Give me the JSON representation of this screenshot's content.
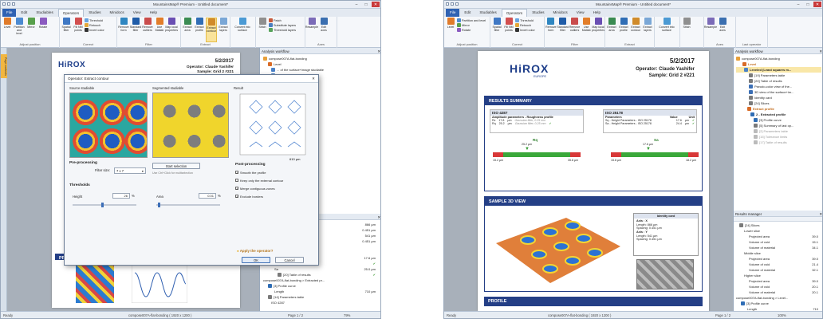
{
  "app": {
    "title": "MountainsMap® Premium - Untitled document*",
    "tabs": [
      "File",
      "Edit",
      "Studiables",
      "Operators",
      "Studies",
      "Minidocs",
      "View",
      "Help"
    ],
    "active_tab": "Operators",
    "ribbon": [
      {
        "group": "Adjust position",
        "buttons": [
          "Level",
          "Partition and level",
          "Mirror",
          "Rotate"
        ]
      },
      {
        "group": "Correct",
        "buttons": [
          "Spatial filter",
          "Fill NM points"
        ],
        "small": [
          "Threshold",
          "Retouch",
          "Invert color"
        ]
      },
      {
        "group": "Filter",
        "buttons": [
          "Remove form",
          "Standard filter",
          "Remove outliers",
          "Use Matlab",
          "Map local properties"
        ]
      },
      {
        "group": "Extract",
        "buttons": [
          "Extract area",
          "Extract profile",
          "Extract contour",
          "Extract layers"
        ]
      },
      {
        "group": "",
        "buttons": [
          "Convert into surface"
        ]
      },
      {
        "group": "",
        "buttons": [
          "Stitch"
        ],
        "small": [
          "Patch",
          "Substitute layers",
          "Threshold layers"
        ]
      },
      {
        "group": "Axes",
        "buttons": [
          "Resample",
          "Edit axes"
        ]
      },
      {
        "group": "Last operator",
        "buttons": []
      }
    ],
    "status": {
      "ready": "Ready",
      "file": "compose007A-flat-bonding ( 1920 x 1200 )",
      "page": "Page 1 / 2",
      "zoom": "100%",
      "zoom_left": "79%"
    }
  },
  "report": {
    "brand": "HiROX",
    "brand_sub": "EUROPE",
    "date": "5/2/2017",
    "operator": "Operator: Claude Yashifer",
    "sample": "Sample: Grid 2 #221",
    "results_title": "RESULTS SUMMARY",
    "iso1": {
      "title": "ISO 4287",
      "params": "Amplitude parameters - Roughness profile",
      "rows": [
        {
          "name": "Rz",
          "val": "17.8",
          "unit": "µm",
          "note": "Gaussian filter, 0.25 mm"
        },
        {
          "name": "Rq",
          "val": "25.2",
          "unit": "µm",
          "note": "Gaussian filter, 0.25 mm"
        }
      ],
      "marker": "Rq",
      "marker_val": "25.2 µm",
      "left": "15.2 µm",
      "right": "35.8 µm"
    },
    "iso2": {
      "title": "ISO 25178",
      "params": "Parameters",
      "value_col": "Value",
      "unit_col": "Unit",
      "rows": [
        {
          "name": "Sq - Height Parameters - ISO 25178",
          "val": "17.6",
          "unit": "µm"
        },
        {
          "name": "Sa - Height Parameters - ISO 25178",
          "val": "24.4",
          "unit": "µm"
        }
      ],
      "marker": "Sa",
      "marker_val": "17.6 µm",
      "left": "15.8 µm",
      "right": "18.2 µm"
    },
    "view_title": "SAMPLE 3D VIEW",
    "identity": {
      "title": "Identity card",
      "axis_x": "Axis : X",
      "len_x": "Length: 866 µm",
      "sp_x": "Spacing: 0.451 µm",
      "axis_y": "Axis : Y",
      "len_y": "Length: 541 µm",
      "sp_y": "Spacing: 0.451 µm"
    },
    "profile_title": "PROFILE"
  },
  "workflow": {
    "title": "Analysis workflow",
    "items_right": [
      "compose007A-flat-bonding",
      "Level",
      "Leveled (Least squares m...",
      "[19] Parameters table",
      "[20] Table of results",
      "Pseudo-color view of the...",
      "3D view of the surface+im...",
      "Identity card",
      "[24] Slices",
      "Extract profile",
      "2 - Extracted profile",
      "[3] Profile curve",
      "[5] Summary of last op...",
      "[2] Parameters table",
      "[15] Tolerance limits",
      "[17] Table of results"
    ],
    "items_left": [
      "compose007A-flat-bonding",
      "Level",
      "... of the surface+image studiable",
      "... surface+image studiable",
      "... card",
      "... results",
      "... limits",
      "... table",
      "... of last operator",
      "... limits",
      "... table"
    ]
  },
  "results_manager": {
    "title": "Results manager",
    "rows": [
      {
        "label": "[24] Slices",
        "value": ""
      },
      {
        "label": "Lower slice",
        "value": ""
      },
      {
        "label": "Projected area",
        "value": "39.0"
      },
      {
        "label": "Volume of void",
        "value": "15.1"
      },
      {
        "label": "Volume of material",
        "value": "34.1"
      },
      {
        "label": "Middle slice",
        "value": ""
      },
      {
        "label": "Projected area",
        "value": "39.0"
      },
      {
        "label": "Volume of void",
        "value": "21.4"
      },
      {
        "label": "Volume of material",
        "value": "32.1"
      },
      {
        "label": "Higher slice",
        "value": ""
      },
      {
        "label": "Projected area",
        "value": "39.0"
      },
      {
        "label": "Volume of void",
        "value": "20.1"
      },
      {
        "label": "Volume of material",
        "value": "20.1"
      },
      {
        "label": "compose007A-flat-bonding > Level...",
        "value": ""
      },
      {
        "label": "[3] Profile curve",
        "value": ""
      },
      {
        "label": "Length",
        "value": "710"
      }
    ],
    "rows_left": [
      {
        "label": "X",
        "value": "866 µm"
      },
      {
        "label": "",
        "value": "0.451 µm"
      },
      {
        "label": "Y",
        "value": "541 µm"
      },
      {
        "label": "",
        "value": "0.451 µm"
      },
      {
        "label": "ISO 25178",
        "value": ""
      },
      {
        "label": "Height Parameters",
        "value": ""
      },
      {
        "label": "Sq",
        "value": "17.6 µm"
      },
      {
        "label": "[20] Table of results",
        "value": ""
      },
      {
        "label": "Sa",
        "value": "25.0 µm"
      },
      {
        "label": "[20] Table of results",
        "value": ""
      },
      {
        "label": "compose007A-flat-bonding > Extracted pr...",
        "value": ""
      },
      {
        "label": "[3] Profile curve",
        "value": ""
      },
      {
        "label": "Length",
        "value": "710 µm"
      },
      {
        "label": "[14] Parameters table",
        "value": ""
      },
      {
        "label": "ISO 4287",
        "value": ""
      }
    ]
  },
  "dialog": {
    "title": "Operator: Extract contour",
    "col1": "Source studiable",
    "col2": "Segmented studiable",
    "col3": "Result",
    "pre": "Pre-processing",
    "filter_label": "Filter size:",
    "filter_value": "7 x 7",
    "start": "Start selection",
    "hint": "Use Ctrl+Click for multiselection",
    "thresholds": "Thresholds",
    "height_label": "Height",
    "height_val": "26",
    "area_label": "Area",
    "area_val": "0.01",
    "pct": "%",
    "post": "Post-processing",
    "checks": [
      {
        "label": "Smooth the profile",
        "on": true
      },
      {
        "label": "Keep only the external contour",
        "on": false
      },
      {
        "label": "Merge contiguous zones",
        "on": true
      },
      {
        "label": "Exclude borders",
        "on": true
      }
    ],
    "apply": "Apply the operator?",
    "ok": "OK",
    "cancel": "Cancel",
    "axis_max": "610 µm"
  },
  "left_page": {
    "brand": "HiROX",
    "date": "5/2/2017",
    "operator": "Operator: Claude Yashifer",
    "sample": "Sample: Grid 2 #221",
    "strip": "Page contents"
  }
}
